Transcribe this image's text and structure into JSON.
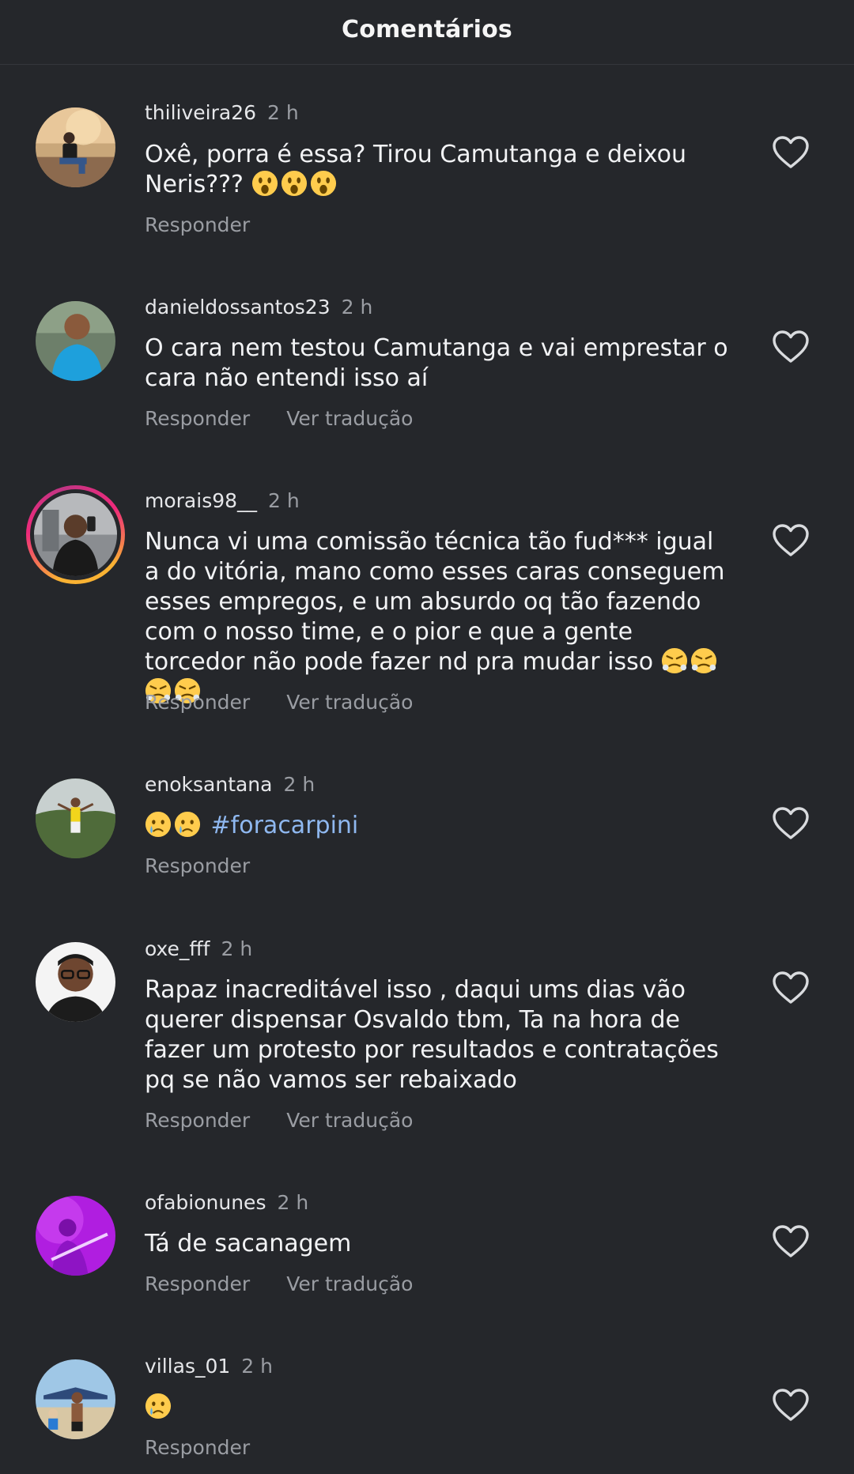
{
  "header": {
    "title": "Comentários"
  },
  "comments": [
    {
      "username": "thiliveira26",
      "time": "2 h",
      "text": "Oxê, porra é essa? Tirou Camutanga e deixou Neris???",
      "emojis": [
        "surprised",
        "surprised",
        "surprised"
      ],
      "reply": "Responder"
    },
    {
      "username": "danieldossantos23",
      "time": "2 h",
      "text": "O cara nem testou Camutanga e vai emprestar o cara não entendi isso aí",
      "reply": "Responder",
      "translate": "Ver tradução"
    },
    {
      "username": "morais98__",
      "time": "2 h",
      "text": "Nunca vi uma comissão técnica tão fud*** igual a do vitória, mano como esses caras conseguem esses empregos, e um absurdo oq tão fazendo com o nosso time, e o pior e que a gente torcedor não pode fazer nd pra mudar isso",
      "emojis": [
        "triumph",
        "triumph",
        "triumph",
        "triumph"
      ],
      "reply": "Responder",
      "translate": "Ver tradução"
    },
    {
      "username": "enoksantana",
      "time": "2 h",
      "hashtag": "#foracarpini",
      "emojis": [
        "crying",
        "crying"
      ],
      "reply": "Responder"
    },
    {
      "username": "oxe_fff",
      "time": "2 h",
      "text": "Rapaz inacreditável isso , daqui ums dias vão querer dispensar Osvaldo tbm, Ta na hora de fazer um protesto por resultados e contratações pq se não vamos ser rebaixado",
      "reply": "Responder",
      "translate": "Ver tradução"
    },
    {
      "username": "ofabionunes",
      "time": "2 h",
      "text": "Tá de sacanagem",
      "reply": "Responder",
      "translate": "Ver tradução"
    },
    {
      "username": "villas_01",
      "time": "2 h",
      "emojis": [
        "crying"
      ],
      "reply": "Responder"
    }
  ],
  "icons": {
    "like": "heart-outline-icon"
  },
  "colors": {
    "background": "#25272b",
    "muted": "#9a9da3",
    "hashtag": "#8fb8f0"
  }
}
